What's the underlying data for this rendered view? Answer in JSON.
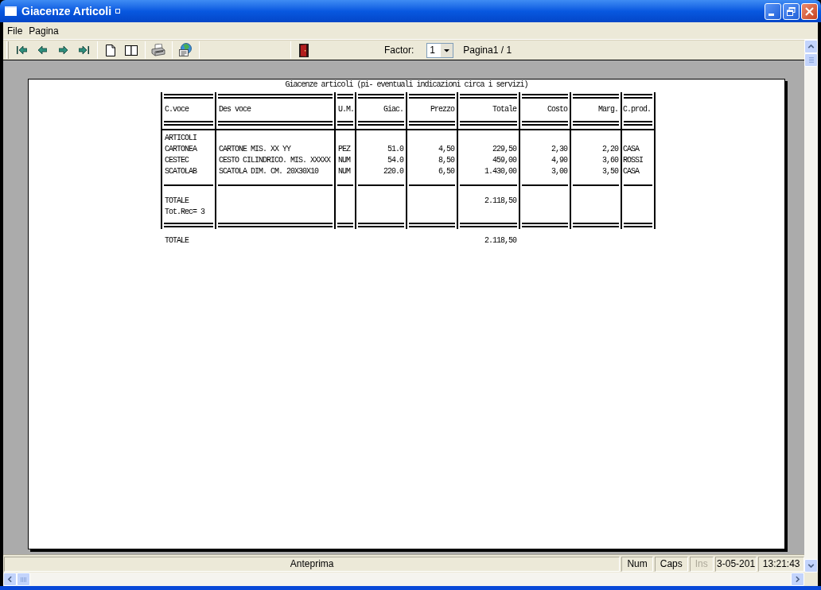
{
  "window": {
    "title": "Giacenze Articoli"
  },
  "menu": [
    "File",
    "Pagina"
  ],
  "toolbar": {
    "factor_label": "Factor:",
    "factor": {
      "value": "1"
    },
    "page_label": "Pagina1 / 1"
  },
  "report": {
    "title": "Giacenze articoli (pi- eventuali indicazioni circa i servizi)",
    "columns": [
      {
        "label": "C.voce",
        "kind": "text"
      },
      {
        "label": "Des voce",
        "kind": "text"
      },
      {
        "label": "U.M.",
        "kind": "text"
      },
      {
        "label": "Giac.",
        "kind": "number"
      },
      {
        "label": "Prezzo",
        "kind": "number"
      },
      {
        "label": "Totale",
        "kind": "total"
      },
      {
        "label": "Costo",
        "kind": "number"
      },
      {
        "label": "Marg.",
        "kind": "number"
      },
      {
        "label": "C.prod.",
        "kind": "text"
      }
    ],
    "group": "ARTICOLI",
    "rows": [
      [
        "CARTONEA",
        "CARTONE MIS. XX YY",
        "PEZ",
        "51.0",
        "4,50",
        "229,50",
        "2,30",
        "2,20",
        "CASA"
      ],
      [
        "CESTEC",
        "CESTO CILINDRICO. MIS. XXXXX",
        "NUM",
        "54.0",
        "8,50",
        "459,00",
        "4,90",
        "3,60",
        "ROSSI"
      ],
      [
        "SCATOLAB",
        "SCATOLA DIM. CM. 20X30X10",
        "NUM",
        "220.0",
        "6,50",
        "1.430,00",
        "3,00",
        "3,50",
        "CASA"
      ]
    ],
    "subtotal": {
      "labels": [
        "TOTALE",
        "Tot.Rec= 3"
      ],
      "amount": "2.118,50"
    },
    "grand_total": {
      "label": "TOTALE",
      "amount": "2.118,50"
    }
  },
  "status_bar": {
    "message": "Anteprima",
    "indicators": [
      {
        "label": "Num",
        "disabled": false
      },
      {
        "label": "Caps",
        "disabled": false
      },
      {
        "label": "Ins",
        "disabled": true
      }
    ],
    "date": "3-05-201",
    "time": "13:21:43"
  }
}
